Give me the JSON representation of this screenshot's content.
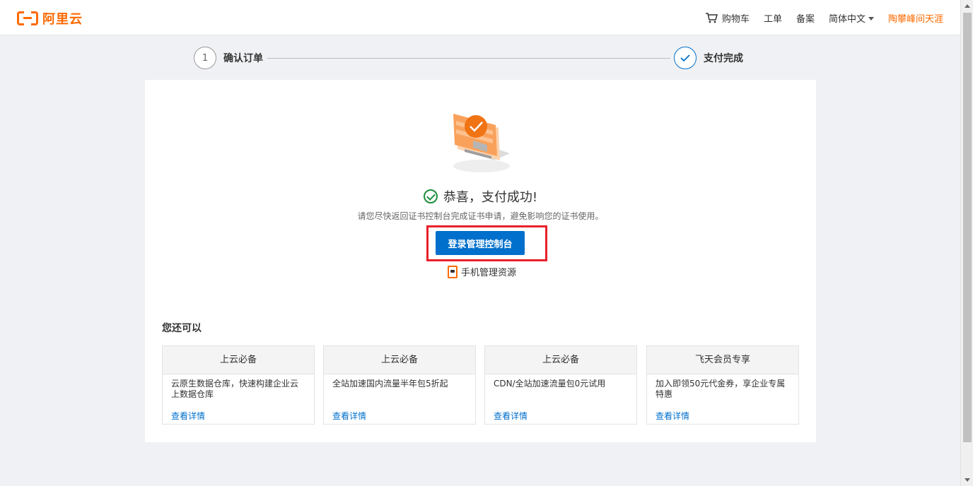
{
  "header": {
    "logo_text": "阿里云",
    "nav": {
      "cart": "购物车",
      "ticket": "工单",
      "filing": "备案",
      "language": "简体中文",
      "user": "陶攀峰间天涯"
    }
  },
  "steps": [
    {
      "number": "1",
      "label": "确认订单"
    },
    {
      "number": "",
      "label": "支付完成"
    }
  ],
  "result": {
    "title": "恭喜，支付成功!",
    "hint": "请您尽快返回证书控制台完成证书申请，避免影响您的证书使用。",
    "console_button": "登录管理控制台",
    "mobile_link": "手机管理资源"
  },
  "more": {
    "title": "您还可以",
    "offers": [
      {
        "head": "上云必备",
        "desc": "云原生数据仓库，快速构建企业云上数据仓库",
        "link": "查看详情"
      },
      {
        "head": "上云必备",
        "desc": "全站加速国内流量半年包5折起",
        "link": "查看详情"
      },
      {
        "head": "上云必备",
        "desc": "CDN/全站加速流量包0元试用",
        "link": "查看详情"
      },
      {
        "head": "飞天会员专享",
        "desc": "加入即领50元代金券，享企业专属特惠",
        "link": "查看详情"
      }
    ]
  },
  "colors": {
    "brand": "#ff6a00",
    "primary": "#0070cc",
    "success": "#1e8e3e",
    "highlight": "#e8202a"
  }
}
